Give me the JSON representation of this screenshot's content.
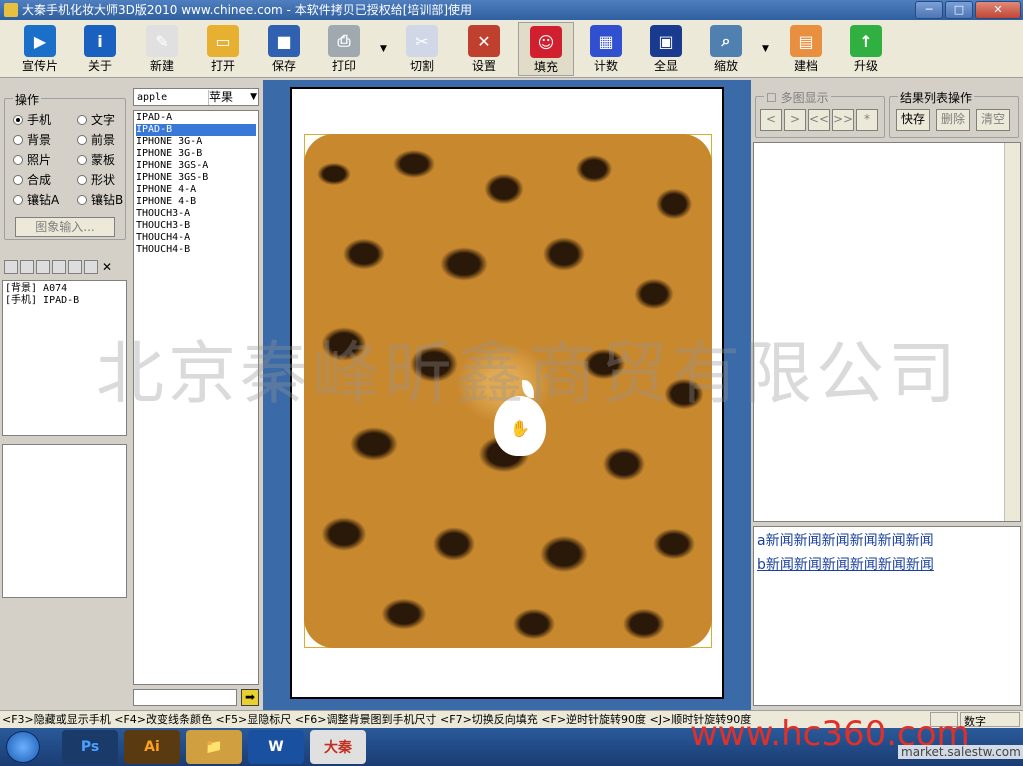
{
  "window": {
    "title": "大秦手机化妆大师3D版2010 www.chinee.com - 本软件拷贝已授权给[培训部]使用",
    "min": "─",
    "max": "□",
    "close": "✕"
  },
  "toolbar": [
    {
      "label": "宣传片",
      "icon": "play-icon",
      "color": "#1a70c8",
      "glyph": "▶"
    },
    {
      "label": "关于",
      "icon": "info-icon",
      "color": "#1a60c0",
      "glyph": "i"
    },
    {
      "label": "新建",
      "icon": "new-file-icon",
      "color": "#e0e0e0",
      "glyph": "✎"
    },
    {
      "label": "打开",
      "icon": "folder-open-icon",
      "color": "#e8b030",
      "glyph": "▭"
    },
    {
      "label": "保存",
      "icon": "floppy-icon",
      "color": "#3060b0",
      "glyph": "■"
    },
    {
      "label": "打印",
      "icon": "printer-icon",
      "color": "#a0a8b0",
      "glyph": "⎙"
    },
    {
      "label": "切割",
      "icon": "cut-icon",
      "color": "#d0d8e8",
      "glyph": "✂"
    },
    {
      "label": "设置",
      "icon": "tools-icon",
      "color": "#c04030",
      "glyph": "✕"
    },
    {
      "label": "填充",
      "icon": "fill-icon",
      "color": "#d02030",
      "glyph": "☺"
    },
    {
      "label": "计数",
      "icon": "counter-icon",
      "color": "#3050d0",
      "glyph": "▦"
    },
    {
      "label": "全显",
      "icon": "fullscreen-icon",
      "color": "#1a3a90",
      "glyph": "▣"
    },
    {
      "label": "缩放",
      "icon": "zoom-icon",
      "color": "#5080b0",
      "glyph": "⌕"
    },
    {
      "label": "建档",
      "icon": "archive-icon",
      "color": "#e89040",
      "glyph": "▤"
    },
    {
      "label": "升级",
      "icon": "upgrade-icon",
      "color": "#30b040",
      "glyph": "↑"
    }
  ],
  "left": {
    "group_title": "操作",
    "radios": [
      [
        "手机",
        "文字"
      ],
      [
        "背景",
        "前景"
      ],
      [
        "照片",
        "蒙板"
      ],
      [
        "合成",
        "形状"
      ],
      [
        "镶钻A",
        "镶钻B"
      ]
    ],
    "selected": "手机",
    "image_input": "图象输入...",
    "layers": [
      "[背景] A074",
      "[手机] IPAD-B"
    ]
  },
  "models": {
    "search_value": "apple",
    "brand_value": "苹果",
    "items": [
      "IPAD-A",
      "IPAD-B",
      "IPHONE 3G-A",
      "IPHONE 3G-B",
      "IPHONE 3GS-A",
      "IPHONE 3GS-B",
      "IPHONE 4-A",
      "IPHONE 4-B",
      "THOUCH3-A",
      "THOUCH3-B",
      "THOUCH4-A",
      "THOUCH4-B"
    ],
    "selected": "IPAD-B",
    "go": "➡"
  },
  "right": {
    "multi_title": "多图显示",
    "nav": [
      "<",
      ">",
      "<<",
      ">>",
      "*"
    ],
    "result_title": "结果列表操作",
    "quick_save": "快存",
    "delete": "删除",
    "clear": "清空",
    "news": [
      "a新闻新闻新闻新闻新闻新闻",
      "b新闻新闻新闻新闻新闻新闻"
    ]
  },
  "statusbar": {
    "text": "<F3>隐藏或显示手机 <F4>改变线条颜色 <F5>显隐标尺 <F6>调整背景图到手机尺寸 <F7>切换反向填充 <F>逆时针旋转90度 <J>顺时针旋转90度",
    "mode": "数字"
  },
  "taskbar": {
    "apps": [
      "Ps",
      "Ai",
      "📁",
      "W",
      "大秦"
    ]
  },
  "watermark": "北京秦峰昕鑫商贸有限公司",
  "site_mark": "www.hc360.com",
  "site_mark2": "market.salestw.com"
}
